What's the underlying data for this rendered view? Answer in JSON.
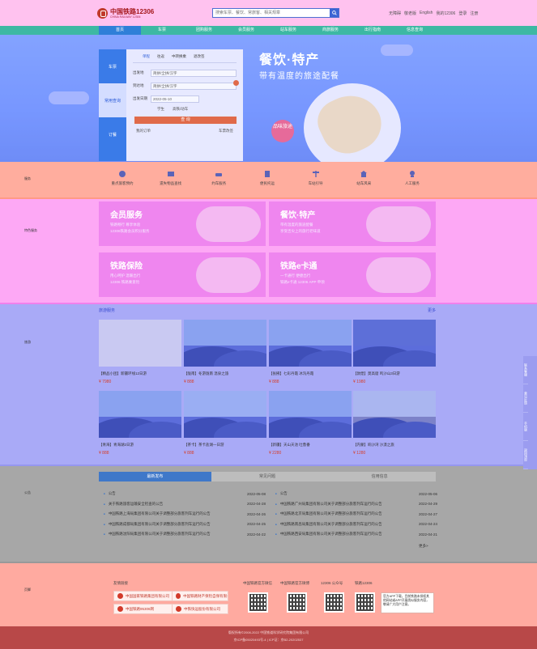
{
  "header": {
    "logo_title": "中国铁路12306",
    "logo_sub": "CHINA RAILWAY 12306",
    "search_placeholder": "搜索车票、餐饮、常旅客、相关规章",
    "links": [
      "无障碍",
      "敬老版",
      "English",
      "我的12306",
      "登录",
      "注册"
    ]
  },
  "nav": [
    "首页",
    "车票",
    "团购服务",
    "会员服务",
    "站车服务",
    "商旅服务",
    "出行指南",
    "信息查询"
  ],
  "booking": {
    "side_tabs": [
      "车票",
      "常用查询",
      "订餐"
    ],
    "form_tabs": [
      "单程",
      "往返",
      "中转换乘",
      "退改签"
    ],
    "from_label": "出发地",
    "from_placeholder": "简拼/全拼/汉字",
    "to_label": "到达地",
    "to_placeholder": "简拼/全拼/汉字",
    "date_label": "出发日期",
    "date_value": "2022-05-10",
    "options": [
      "学生",
      "高铁/动车"
    ],
    "query_button": "查 询",
    "footer_left": "我的订单",
    "footer_right": "车票改签"
  },
  "hero": {
    "title": "餐饮·特产",
    "subtitle": "带有温度的旅途配餐",
    "badge": "品味旅途"
  },
  "sections": {
    "services_label": "服务",
    "promos_label": "特色服务",
    "travel_label": "旅游",
    "news_label": "公告",
    "footer_label": "页脚"
  },
  "services": [
    "重点旅客预约",
    "遗失物品查找",
    "约车服务",
    "便民托运",
    "车站引导",
    "站车风采",
    "人工服务"
  ],
  "promos": [
    {
      "title": "会员服务",
      "lines": [
        "铁路畅行 尊享体验",
        "12306铁路会员积分服务"
      ]
    },
    {
      "title": "餐饮·特产",
      "lines": [
        "带有温度的旅途配餐",
        "享受舌尖上的旅行老味道"
      ]
    },
    {
      "title": "铁路保险",
      "lines": [
        "用心呵护 温暖出行",
        "12306 铁路乘意险"
      ]
    },
    {
      "title": "铁路e卡通",
      "lines": [
        "一卡通行 便捷出行",
        "铁路e卡通 12306 APP 申领"
      ]
    }
  ],
  "travel": {
    "header_left": "旅游服务",
    "header_right": "更多",
    "tiles": [
      {
        "caption": "【精品小团】新疆环线12日游",
        "price": "¥ 7980"
      },
      {
        "caption": "【陇南】冬游陇南 温泉之旅",
        "price": "¥ 888"
      },
      {
        "caption": "【张掖】七彩丹霞 冰沟丹霞",
        "price": "¥ 888"
      },
      {
        "caption": "【敦煌】莫高窟 鸣沙山3日游",
        "price": "¥ 1980"
      },
      {
        "caption": "【青海】青海湖2日游",
        "price": "¥ 888"
      },
      {
        "caption": "【茶卡】茶卡盐湖一日游",
        "price": "¥ 888"
      },
      {
        "caption": "【新疆】天山天池 吐鲁番",
        "price": "¥ 2280"
      },
      {
        "caption": "【内蒙】响沙湾 沙漠之旅",
        "price": "¥ 1280"
      }
    ]
  },
  "news": {
    "tabs": [
      "最新发布",
      "常见问题",
      "信用信息"
    ],
    "left": [
      {
        "title": "公告",
        "date": "2022-05-08"
      },
      {
        "title": "关于铁路旅客运输安全检查的公告",
        "date": "2022-04-28"
      },
      {
        "title": "中国铁路上海局集团有限公司关于调整部分旅客列车运行的公告",
        "date": "2022-04-26"
      },
      {
        "title": "中国铁路成都局集团有限公司关于调整部分旅客列车运行的公告",
        "date": "2022-04-25"
      },
      {
        "title": "中国铁路沈阳局集团有限公司关于调整部分旅客列车运行的公告",
        "date": "2022-04-22"
      }
    ],
    "right": [
      {
        "title": "公告",
        "date": "2022-05-06"
      },
      {
        "title": "中国铁路广州局集团有限公司关于调整部分旅客列车运行的公告",
        "date": "2022-04-29"
      },
      {
        "title": "中国铁路北京局集团有限公司关于调整部分旅客列车运行的公告",
        "date": "2022-04-27"
      },
      {
        "title": "中国铁路南昌局集团有限公司关于调整部分旅客列车运行的公告",
        "date": "2022-04-24"
      },
      {
        "title": "中国铁路西安局集团有限公司关于调整部分旅客列车运行的公告",
        "date": "2022-04-21"
      }
    ],
    "more": "更多>"
  },
  "footer": {
    "links_heading": "友情链接",
    "partner1": "中国国家铁路集团有限公司",
    "partner2": "中国铁路财产保险自保有限公司",
    "partner3": "中国铁路95306网",
    "partner4": "中铁快运股份有限公司",
    "qr_headings": [
      "中国铁路官方微信",
      "中国铁路官方微博",
      "12306 公众号",
      "铁路12306"
    ],
    "notice": "官方APP下载，目前铁路未授权其他网站或APP开展类似服务内容，敬请广大用户注意。",
    "copyright": "版权所有©2008-2022 中国铁道科学研究院集团有限公司",
    "icp": "京ICP备05020493号-4 | ICP证：京B2-20202537"
  },
  "side_float": [
    "联系客服",
    "意见反馈",
    "手机版",
    "返回顶部"
  ],
  "colors": {
    "nav": "#3db8a3",
    "nav_active": "#2f7fd8",
    "accent_red": "#d6402e",
    "brand_red": "#a4161a"
  }
}
